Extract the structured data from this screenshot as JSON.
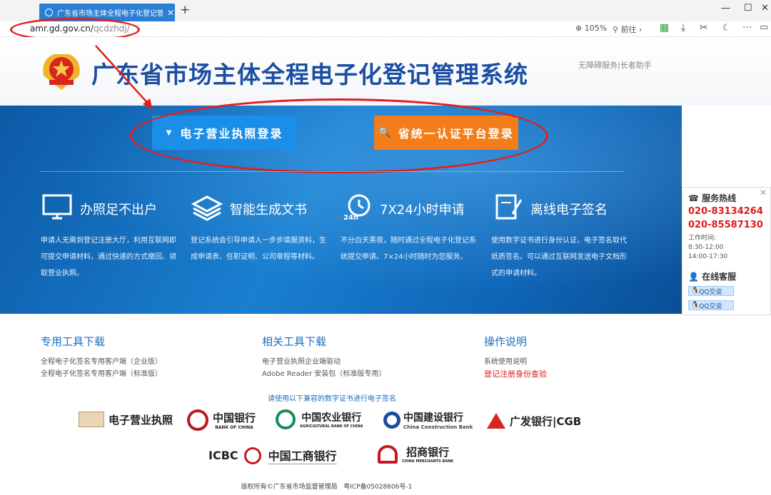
{
  "browser": {
    "tab_title": "广东省市场主体全程电子化登记管理",
    "url_host": "amr.gd.gov.cn/",
    "url_path": "qcdzhdj/",
    "zoom": "105%",
    "forward": "前往"
  },
  "header": {
    "title": "广东省市场主体全程电子化登记管理系统",
    "assist": "无障碍服务|长者助手"
  },
  "buttons": {
    "license_login": "电子营业执照登录",
    "unified_login": "省统一认证平台登录"
  },
  "features": [
    {
      "title": "办照足不出户",
      "desc": "申请人无需到登记注册大厅，利用互联网即可提交申请材料，通过快递的方式缴回、领取营业执照。"
    },
    {
      "title": "智能生成文书",
      "desc": "登记系统会引导申请人一步步填报资料，生成申请表、任职证明、公司章程等材料。"
    },
    {
      "title": "7X24小时申请",
      "desc": "不分白天黑夜，随时通过全程电子化登记系统提交申请。7×24小时随时为您服务。"
    },
    {
      "title": "离线电子签名",
      "desc": "使用数字证书进行身份认证，电子签名取代纸质签名。可以通过互联网发送电子文档形式的申请材料。"
    }
  ],
  "service": {
    "hotline": "服务热线",
    "phone1": "020-83134264",
    "phone2": "020-85587130",
    "hours_label": "工作时间:",
    "hours1": "8:30-12:00",
    "hours2": "14:00-17:30",
    "online": "在线客服",
    "qq1": "QQ交谈",
    "qq2": "QQ交谈"
  },
  "downloads": {
    "tools": {
      "heading": "专用工具下载",
      "items": [
        "全程电子化签名专用客户端（企业版）",
        "全程电子化签名专用客户端（标准版）"
      ]
    },
    "related": {
      "heading": "相关工具下载",
      "items": [
        "电子营业执照企业端驱动",
        "Adobe Reader 安装包（标准版专用）"
      ]
    },
    "guide": {
      "heading": "操作说明",
      "items": [
        "系统使用说明"
      ],
      "highlight": "登记注册身份查验"
    }
  },
  "notice": "请使用以下兼容的数字证书进行电子签名",
  "logos": {
    "e_license": "电子营业执照",
    "boc": "中国银行",
    "boc_en": "BANK OF CHINA",
    "abc": "中国农业银行",
    "abc_en": "AGRICULTURAL BANK OF CHINA",
    "ccb": "中国建设银行",
    "ccb_en": "China Construction Bank",
    "cgb": "广发银行|CGB",
    "icbc_en": "ICBC",
    "icbc": "中国工商银行",
    "cmb": "招商银行",
    "cmb_en": "CHINA MERCHANTS BANK"
  },
  "footer": {
    "copyright": "版权所有©广东省市场监督管理局",
    "icp": "粤ICP备05028606号-1"
  },
  "colors": {
    "brand_blue": "#1b4ea3",
    "accent_orange": "#f27d1a",
    "annotation_red": "#e0201c"
  }
}
